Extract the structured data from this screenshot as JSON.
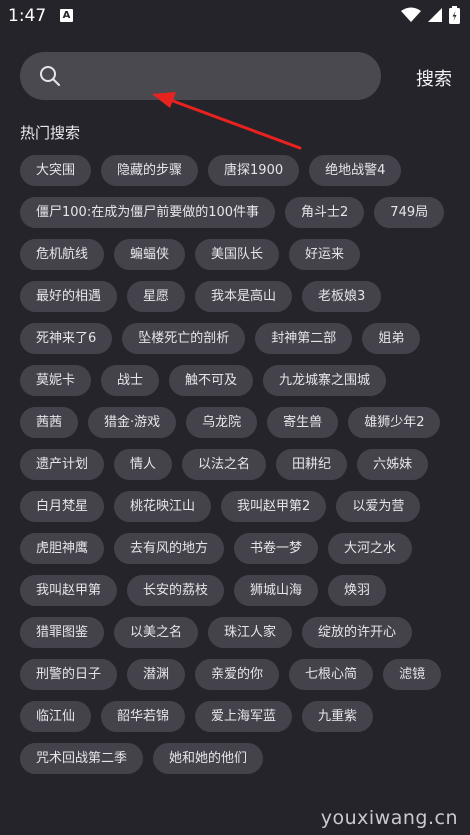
{
  "status_bar": {
    "time": "1:47",
    "notification_badge": "A"
  },
  "search": {
    "placeholder": "",
    "button_label": "搜索"
  },
  "hot_section": {
    "title": "热门搜索",
    "tags": [
      "大突围",
      "隐藏的步骤",
      "唐探1900",
      "绝地战警4",
      "僵尸100:在成为僵尸前要做的100件事",
      "角斗士2",
      "749局",
      "危机航线",
      "蝙蝠侠",
      "美国队长",
      "好运来",
      "最好的相遇",
      "星愿",
      "我本是高山",
      "老板娘3",
      "死神来了6",
      "坠楼死亡的剖析",
      "封神第二部",
      "姐弟",
      "莫妮卡",
      "战士",
      "触不可及",
      "九龙城寨之围城",
      "茜茜",
      "猎金·游戏",
      "乌龙院",
      "寄生兽",
      "雄狮少年2",
      "遗产计划",
      "情人",
      "以法之名",
      "田耕纪",
      "六姊妹",
      "白月梵星",
      "桃花映江山",
      "我叫赵甲第2",
      "以爱为营",
      "虎胆神鹰",
      "去有风的地方",
      "书卷一梦",
      "大河之水",
      "我叫赵甲第",
      "长安的荔枝",
      "狮城山海",
      "焕羽",
      "猎罪图鉴",
      "以美之名",
      "珠江人家",
      "绽放的许开心",
      "刑警的日子",
      "潜渊",
      "亲爱的你",
      "七根心简",
      "滤镜",
      "临江仙",
      "韶华若锦",
      "爱上海军蓝",
      "九重紫",
      "咒术回战第二季",
      "她和她的他们"
    ]
  },
  "watermark": "youxiwang.cn",
  "colors": {
    "background": "#25242a",
    "search_box": "#4a4950",
    "tag": "#44434b",
    "arrow": "#e8231f"
  }
}
